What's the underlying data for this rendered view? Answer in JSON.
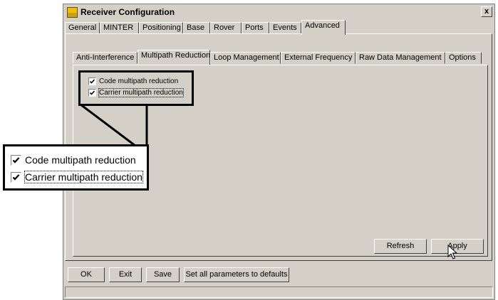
{
  "window": {
    "title": "Receiver Configuration",
    "close_label": "x"
  },
  "main_tabs": [
    {
      "label": "General"
    },
    {
      "label": "MINTER"
    },
    {
      "label": "Positioning"
    },
    {
      "label": "Base"
    },
    {
      "label": "Rover"
    },
    {
      "label": "Ports"
    },
    {
      "label": "Events"
    },
    {
      "label": "Advanced"
    }
  ],
  "sub_tabs": [
    {
      "label": "Anti-Interference"
    },
    {
      "label": "Multipath Reduction"
    },
    {
      "label": "Loop Management"
    },
    {
      "label": "External Frequency"
    },
    {
      "label": "Raw Data Management"
    },
    {
      "label": "Options"
    }
  ],
  "options": {
    "code_multipath": {
      "label": "Code multipath reduction",
      "checked": true
    },
    "carrier_multipath": {
      "label": "Carrier multipath reduction",
      "checked": true
    }
  },
  "buttons": {
    "refresh": "Refresh",
    "apply": "Apply",
    "ok": "OK",
    "exit": "Exit",
    "save": "Save",
    "defaults": "Set all parameters to defaults"
  }
}
